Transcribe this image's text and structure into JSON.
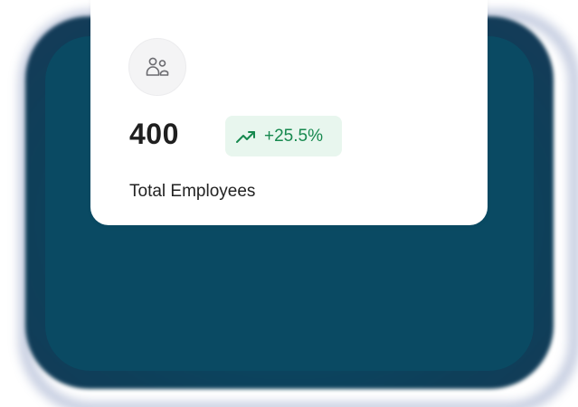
{
  "stat_card": {
    "icon": "users-icon",
    "value": "400",
    "trend": {
      "icon": "trending-up-icon",
      "text": "+25.5%",
      "color": "#17894f",
      "background": "#e8f6ee"
    },
    "label": "Total Employees"
  },
  "colors": {
    "backdrop": "#0a4a63",
    "card": "#ffffff"
  }
}
